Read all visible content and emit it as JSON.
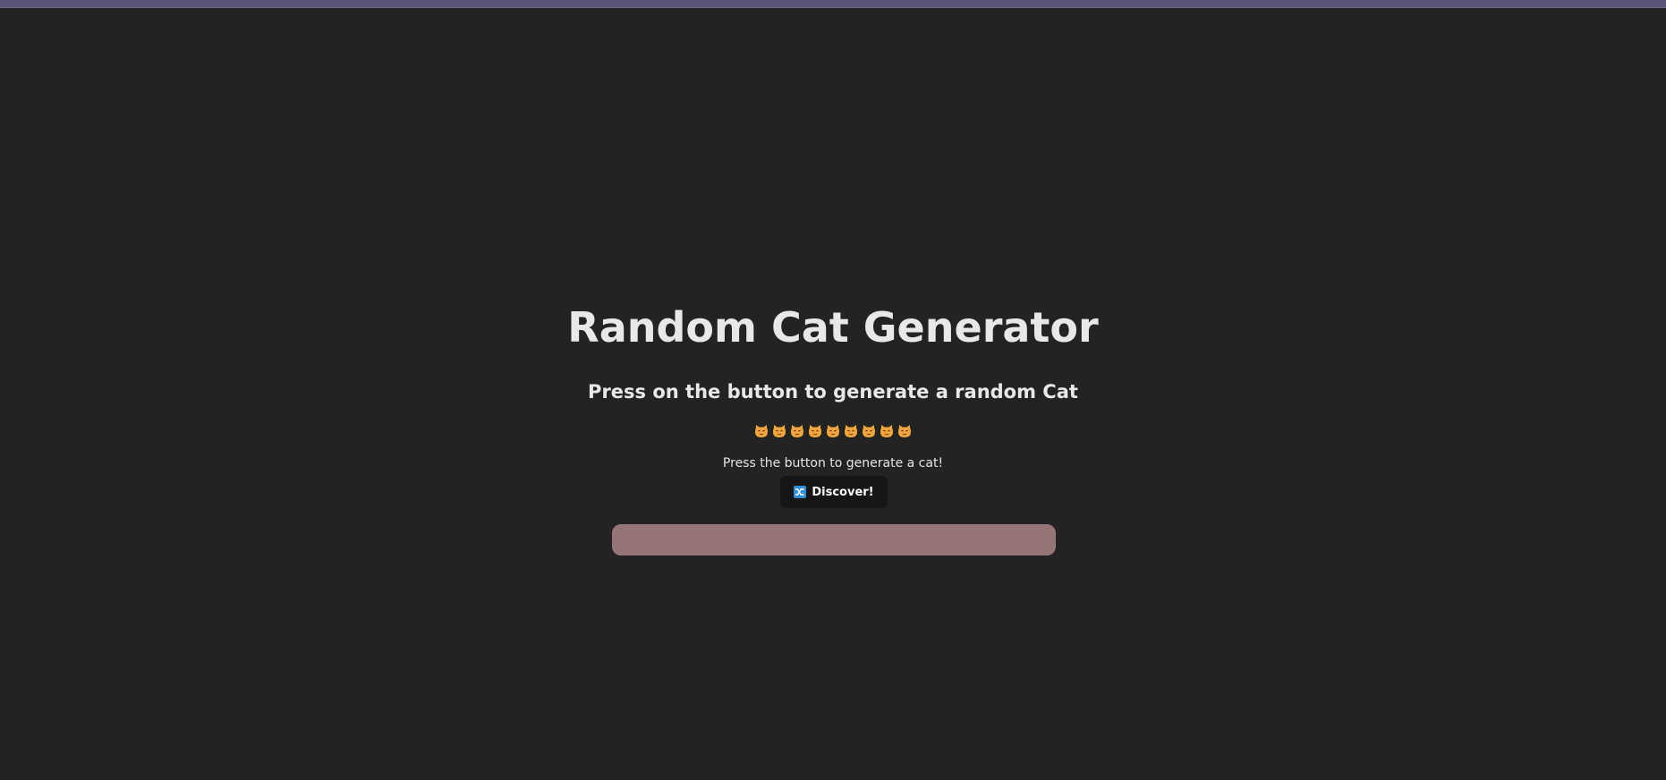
{
  "page": {
    "title": "Random Cat Generator",
    "subtitle": "Press on the button to generate a random Cat",
    "hint": "Press the button to generate a cat!"
  },
  "cat_emojis": [
    "😼",
    "😽",
    "😹",
    "😾",
    "😸",
    "😿",
    "🙀",
    "😺",
    "😼"
  ],
  "discover_button": {
    "label": "Discover!",
    "icon": "shuffle-icon"
  },
  "colors": {
    "background": "#232323",
    "top_strip": "#5b5677",
    "text": "#e8e8e8",
    "button_bg": "#161616",
    "cat_display_bg": "#957578",
    "cat_emoji": "#f0a63a",
    "shuffle_icon": "#2f8fd8"
  }
}
